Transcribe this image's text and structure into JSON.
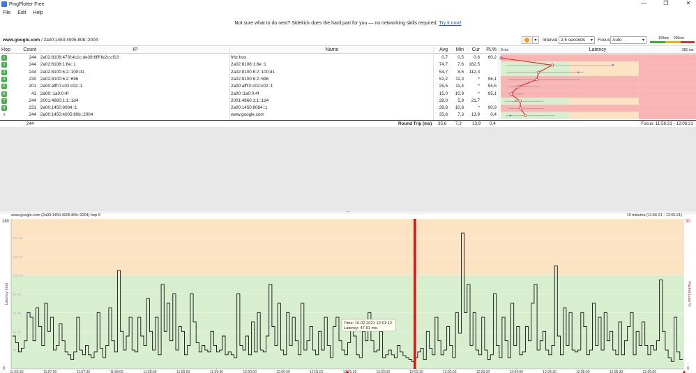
{
  "window": {
    "title": "PingPlotter Free",
    "controls": [
      "—",
      "❐",
      "✕"
    ]
  },
  "menu": [
    "File",
    "Edit",
    "Help"
  ],
  "banner": {
    "text": "Not sure what to do next? Sidekick does the hard part for you — no networking skills required.",
    "link": "Try it now!"
  },
  "toolbar": {
    "target_host": "www.google.com",
    "target_ip": " / 2a00:1450:4005:80b::2004",
    "interval_label": "Interval",
    "interval_value": "2,5 seconds",
    "focus_label": "Focus",
    "focus_value": "Auto",
    "legend": [
      "100ms",
      "200ms"
    ],
    "colors": {
      "good": "#2fb82f",
      "warn": "#f0b400",
      "bad": "#e03030"
    }
  },
  "grid": {
    "headers": {
      "hop": "Hop",
      "count": "Count",
      "ip": "IP",
      "name": "Name",
      "avg": "Avg",
      "min": "Min",
      "cur": "Cur",
      "pl": "PL%",
      "latency": "Latency"
    },
    "latency_scale": {
      "min_label": "0 ms",
      "max_label": "281 ms"
    },
    "rows": [
      {
        "hop": "1",
        "count": "244",
        "ip": "2a02:8108:473f:4c1c:de39:6fff:fe2c:cf13",
        "name": "fritz.box",
        "avg": "0,7",
        "min": "0,5",
        "cur": "0,6",
        "pl": "60,2"
      },
      {
        "hop": "2",
        "count": "244",
        "ip": "2a02:8108:1:8e::1",
        "name": "2a02:8108:1:8e::1",
        "avg": "74,7",
        "min": "7,6",
        "cur": "162,5",
        "pl": ""
      },
      {
        "hop": "3",
        "count": "244",
        "ip": "2a02:8100:6:2::100:d1",
        "name": "2a02:8100:6:2::100:d1",
        "avg": "54,7",
        "min": "8,6",
        "cur": "112,3",
        "pl": ""
      },
      {
        "hop": "4",
        "count": "230",
        "ip": "2a02:8100:6:2::696",
        "name": "2a02:8100:6:2::696",
        "avg": "52,2",
        "min": "11,3",
        "cur": "*",
        "pl": "96,1"
      },
      {
        "hop": "5",
        "count": "201",
        "ip": "2a00:afff:0:c02:c02::1",
        "name": "2a00:afff:0:c02:c02::1",
        "avg": "25,5",
        "min": "11,4",
        "cur": "*",
        "pl": "94,5"
      },
      {
        "hop": "6",
        "count": "41",
        "ip": "2a00::1a0:0:4f",
        "name": "2a00::1a0:0:4f",
        "avg": "15,0",
        "min": "10,9",
        "cur": "*",
        "pl": "95,1"
      },
      {
        "hop": "7",
        "count": "244",
        "ip": "2001:4860:1:1::1d4",
        "name": "2001:4860:1:1::1d4",
        "avg": "28,0",
        "min": "5,9",
        "cur": "21,7",
        "pl": ""
      },
      {
        "hop": "8",
        "count": "231",
        "ip": "2a00:1450:8084::1",
        "name": "2a00:1450:8084::1",
        "avg": "28,8",
        "min": "10,8",
        "cur": "*",
        "pl": "90,9"
      },
      {
        "hop": "9",
        "count": "244",
        "ip": "2a00:1450:4005:80b::2004",
        "name": "www.google.com",
        "avg": "35,8",
        "min": "7,3",
        "cur": "13,9",
        "pl": "0,4"
      }
    ],
    "footer": {
      "count": "244",
      "label": "Round Trip (ms)",
      "avg": "35,8",
      "min": "7,3",
      "cur": "13,9",
      "pl": "0,4",
      "focus": "Focus: 11:56:21 - 12:06:21"
    }
  },
  "graph": {
    "title": "www.google.com (2a00:1450:4005:80b::2004) hop 9",
    "range": "10 minutes (11:56:21 - 12:06:21)",
    "tooltip": {
      "time": "Time: 10.02.2021 12:01:12.",
      "latency": "Latency: 47,91 ms."
    }
  },
  "chart_data": {
    "type": "line",
    "title": "www.google.com (2a00:1450:4005:80b::2004) hop 9",
    "ylabel": "Latency (ms)",
    "y2label": "Packet Loss %",
    "ylim": [
      0,
      160
    ],
    "y2lim": [
      0,
      30
    ],
    "yticks": [
      0,
      160
    ],
    "y2ticks": [
      0,
      30
    ],
    "ygrid_labels": [
      "20 ms",
      "40 ms",
      "60 ms",
      "80 ms",
      "100 ms",
      "120 ms",
      "140 ms"
    ],
    "bands": [
      {
        "from": 0,
        "to": 100,
        "color": "#d8efcf"
      },
      {
        "from": 100,
        "to": 160,
        "color": "#fbe3c4"
      }
    ],
    "xticks": [
      "11:56:30",
      "11:57:00",
      "11:57:30",
      "11:58:00",
      "11:58:30",
      "11:59:00",
      "11:59:30",
      "12:00:00",
      "12:00:30",
      "12:01:00",
      "12:01:30",
      "12:02:00",
      "12:02:30",
      "12:03:00",
      "12:03:30",
      "12:04:00",
      "12:04:30",
      "12:05:00",
      "12:05:30",
      "12:06:00"
    ],
    "loss_marker_time": "12:02:20",
    "series": [
      {
        "values": [
          35,
          28,
          18,
          22,
          30,
          60,
          55,
          30,
          65,
          45,
          25,
          70,
          40,
          55,
          20,
          25,
          48,
          30,
          18,
          15,
          10,
          18,
          55,
          20,
          15,
          25,
          15,
          12,
          18,
          60,
          22,
          12,
          25,
          65,
          30,
          18,
          105,
          40,
          20,
          35,
          55,
          20,
          18,
          55,
          35,
          25,
          75,
          40,
          20,
          55,
          15,
          90,
          40,
          70,
          30,
          80,
          20,
          45,
          40,
          15,
          25,
          80,
          50,
          28,
          18,
          25,
          20,
          18,
          40,
          25,
          18,
          20,
          35,
          15,
          18,
          15,
          12,
          80,
          25,
          20,
          35,
          15,
          50,
          18,
          60,
          20,
          18,
          35,
          90,
          45,
          25,
          70,
          20,
          15,
          60,
          25,
          55,
          30,
          15,
          70,
          20,
          30,
          45,
          20,
          15,
          40,
          20,
          55,
          25,
          12,
          45,
          55,
          30,
          20,
          15,
          28,
          45,
          35,
          15,
          12,
          40,
          30,
          60,
          30,
          18,
          20,
          40,
          12,
          15,
          20,
          15,
          12,
          25,
          18,
          14,
          12,
          10,
          8,
          12,
          18,
          22,
          10,
          40,
          22,
          15,
          55,
          30,
          15,
          20,
          45,
          25,
          12,
          60,
          38,
          145,
          60,
          90,
          25,
          60,
          20,
          15,
          55,
          20,
          10,
          15,
          80,
          25,
          12,
          55,
          30,
          12,
          70,
          25,
          45,
          15,
          18,
          45,
          30,
          70,
          90,
          20,
          30,
          40,
          20,
          15,
          25,
          110,
          35,
          15,
          65,
          25,
          60,
          20,
          18,
          20,
          60,
          45,
          15,
          20,
          70,
          25,
          55,
          20,
          60,
          30,
          40,
          20,
          15,
          50,
          15,
          30,
          45,
          60,
          15,
          40,
          25,
          50,
          25,
          15,
          25,
          20,
          30,
          95,
          40,
          20,
          12,
          8,
          55,
          18,
          10
        ]
      }
    ]
  }
}
